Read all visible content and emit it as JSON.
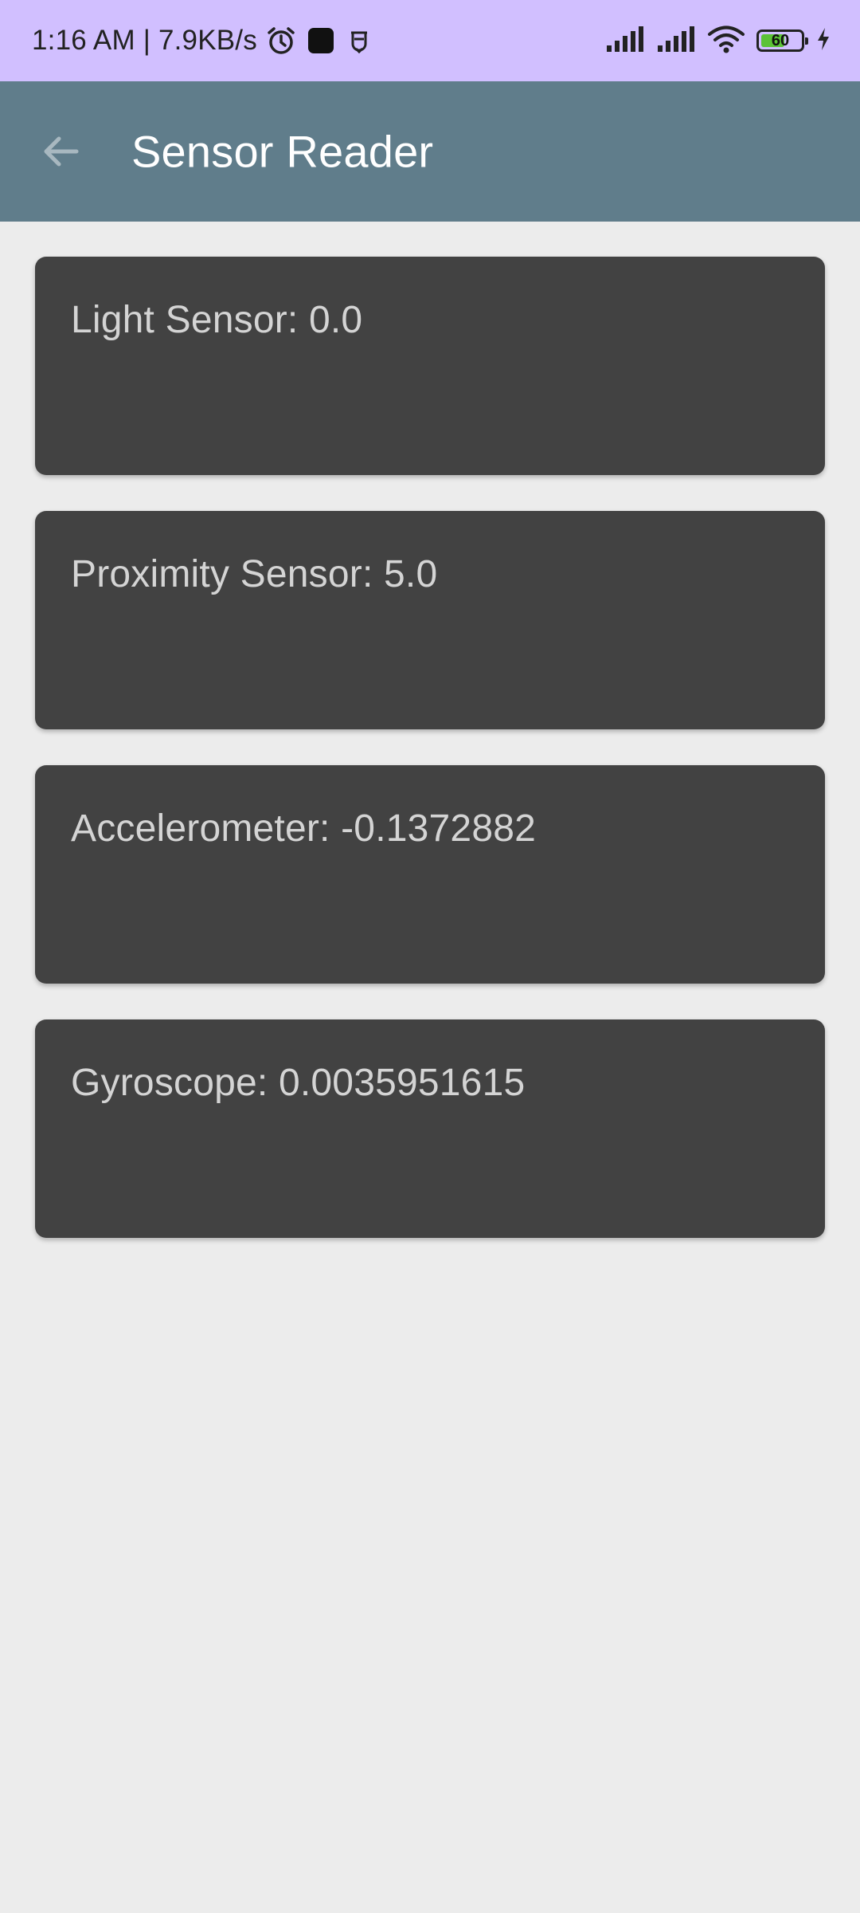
{
  "status_bar": {
    "time_speed": "1:16 AM | 7.9KB/s",
    "battery_level": "60",
    "battery_fraction": 0.6,
    "background_color": "#d1bfff",
    "icons": [
      "alarm-icon",
      "app-square-icon",
      "notification-face-icon",
      "signal-icon",
      "signal-icon",
      "wifi-icon",
      "battery-icon",
      "charging-bolt-icon"
    ]
  },
  "app_bar": {
    "title": "Sensor Reader",
    "back_icon": "arrow-back-icon",
    "color": "#607d8b"
  },
  "cards": [
    {
      "text": "Light Sensor: 0.0"
    },
    {
      "text": "Proximity Sensor: 5.0"
    },
    {
      "text": "Accelerometer: -0.1372882"
    },
    {
      "text": "Gyroscope: 0.0035951615"
    }
  ],
  "colors": {
    "background": "#ececec",
    "card": "#424242",
    "card_text": "#d4d4d4"
  }
}
